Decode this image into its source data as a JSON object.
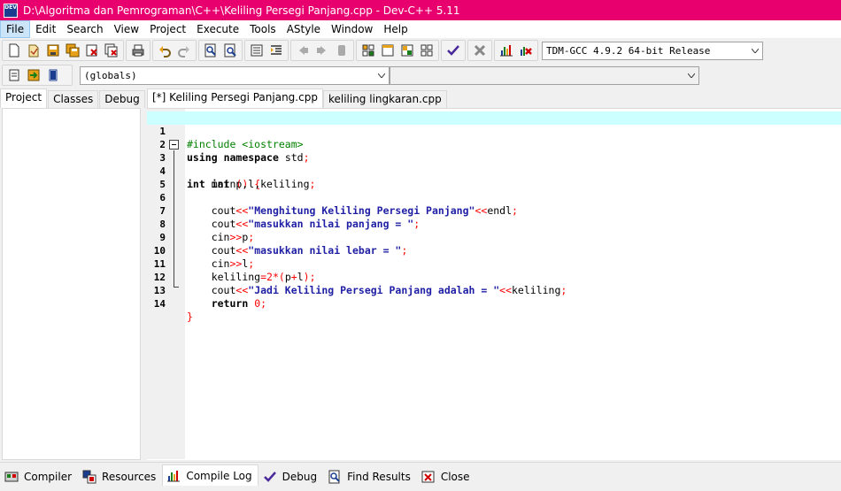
{
  "window": {
    "title": "D:\\Algoritma dan Pemrograman\\C++\\Keliling Persegi Panjang.cpp - Dev-C++ 5.11",
    "app_icon_text": "DEV"
  },
  "menu": [
    "File",
    "Edit",
    "Search",
    "View",
    "Project",
    "Execute",
    "Tools",
    "AStyle",
    "Window",
    "Help"
  ],
  "compiler_select": {
    "value": "TDM-GCC 4.9.2 64-bit Release"
  },
  "scope_select": {
    "value": "(globals)"
  },
  "function_select": {
    "value": ""
  },
  "left_tabs": [
    "Project",
    "Classes",
    "Debug"
  ],
  "file_tabs": [
    "[*] Keliling Persegi Panjang.cpp",
    "keliling lingkaran.cpp"
  ],
  "code": {
    "line_numbers": [
      "1",
      "2",
      "3",
      "4",
      "5",
      "6",
      "7",
      "8",
      "9",
      "10",
      "11",
      "12",
      "13",
      "14"
    ],
    "l1": {
      "pp": "#include <iostream>"
    },
    "l2": {
      "kw1": "using",
      "kw2": "namespace",
      "id": "std",
      "op": ";"
    },
    "l3": {
      "kw": "int",
      "id": "main",
      "op": "() {"
    },
    "l4": {
      "kw": "int",
      "id": "p,l,keliling",
      "op": ";"
    },
    "l6": {
      "id1": "cout",
      "op1": "<<",
      "str": "\"Menghitung Keliling Persegi Panjang\"",
      "op2": "<<",
      "id2": "endl",
      "op3": ";"
    },
    "l7": {
      "id": "cout",
      "op1": "<<",
      "str": "\"masukkan nilai panjang = \"",
      "op2": ";"
    },
    "l8": {
      "id1": "cin",
      "op1": ">>",
      "id2": "p",
      "op2": ";"
    },
    "l9": {
      "id": "cout",
      "op1": "<<",
      "str": "\"masukkan nilai lebar = \"",
      "op2": ";"
    },
    "l10": {
      "id1": "cin",
      "op1": ">>",
      "id2": "l",
      "op2": ";"
    },
    "l11": {
      "id1": "keliling",
      "op1": "=",
      "num": "2",
      "op2": "*(",
      "id2": "p",
      "op3": "+",
      "id3": "l",
      "op4": ");"
    },
    "l12": {
      "id1": "cout",
      "op1": "<<",
      "str": "\"Jadi Keliling Persegi Panjang adalah = \"",
      "op2": "<<",
      "id2": "keliling",
      "op3": ";"
    },
    "l13": {
      "kw": "return",
      "num": "0",
      "op": ";"
    },
    "l14": {
      "op": "}"
    }
  },
  "bottom_tabs": [
    {
      "label": "Compiler",
      "icon": "compiler-icon"
    },
    {
      "label": "Resources",
      "icon": "resources-icon"
    },
    {
      "label": "Compile Log",
      "icon": "compile-log-icon"
    },
    {
      "label": "Debug",
      "icon": "debug-icon"
    },
    {
      "label": "Find Results",
      "icon": "find-results-icon"
    },
    {
      "label": "Close",
      "icon": "close-icon"
    }
  ]
}
